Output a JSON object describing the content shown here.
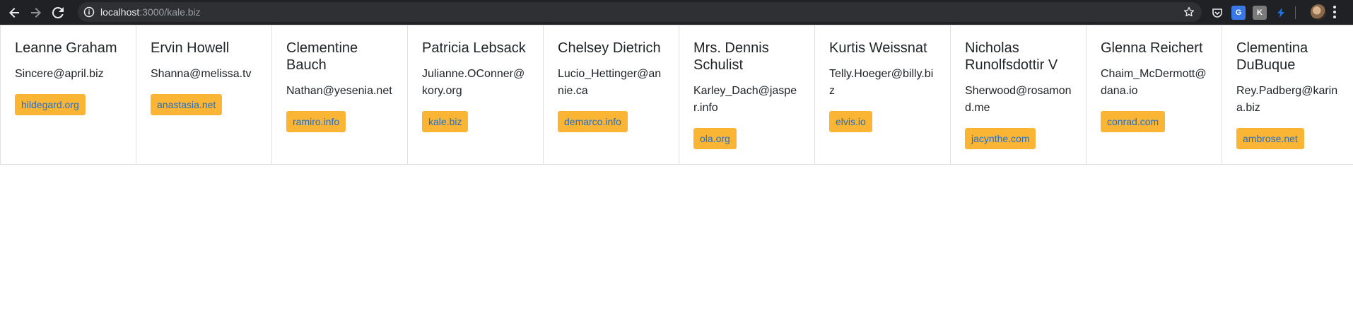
{
  "browser": {
    "url_host": "localhost",
    "url_rest": ":3000/kale.biz"
  },
  "users": [
    {
      "name": "Leanne Graham",
      "email": "Sincere@april.biz",
      "website": "hildegard.org"
    },
    {
      "name": "Ervin Howell",
      "email": "Shanna@melissa.tv",
      "website": "anastasia.net"
    },
    {
      "name": "Clementine Bauch",
      "email": "Nathan@yesenia.net",
      "website": "ramiro.info"
    },
    {
      "name": "Patricia Lebsack",
      "email": "Julianne.OConner@kory.org",
      "website": "kale.biz"
    },
    {
      "name": "Chelsey Dietrich",
      "email": "Lucio_Hettinger@annie.ca",
      "website": "demarco.info"
    },
    {
      "name": "Mrs. Dennis Schulist",
      "email": "Karley_Dach@jasper.info",
      "website": "ola.org"
    },
    {
      "name": "Kurtis Weissnat",
      "email": "Telly.Hoeger@billy.biz",
      "website": "elvis.io"
    },
    {
      "name": "Nicholas Runolfsdottir V",
      "email": "Sherwood@rosamond.me",
      "website": "jacynthe.com"
    },
    {
      "name": "Glenna Reichert",
      "email": "Chaim_McDermott@dana.io",
      "website": "conrad.com"
    },
    {
      "name": "Clementina DuBuque",
      "email": "Rey.Padberg@karina.biz",
      "website": "ambrose.net"
    }
  ],
  "colors": {
    "badge_bg": "#fbb534",
    "badge_text": "#1f6fd1"
  },
  "icons": {
    "back": "back-arrow-icon",
    "forward": "forward-arrow-icon",
    "reload": "reload-icon",
    "info": "info-icon",
    "star": "star-icon",
    "menu": "kebab-menu-icon"
  }
}
